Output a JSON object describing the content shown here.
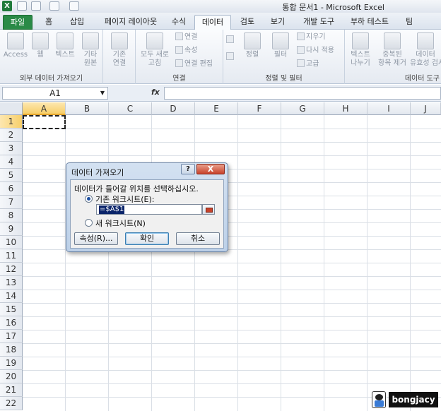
{
  "window": {
    "title": "통합 문서1 - Microsoft Excel"
  },
  "tabs": [
    "파일",
    "홈",
    "삽입",
    "페이지 레이아웃",
    "수식",
    "데이터",
    "검토",
    "보기",
    "개발 도구",
    "부하 테스트",
    "팀"
  ],
  "ribbon": {
    "get_external": {
      "label": "외부 데이터 가져오기",
      "access": "Access",
      "web": "웹",
      "text": "텍스트",
      "other_l1": "기타",
      "other_l2": "원본"
    },
    "existing": {
      "l1": "기존",
      "l2": "연결"
    },
    "connections": {
      "label": "연결",
      "refresh_l1": "모두 새로",
      "refresh_l2": "고침",
      "conn": "연결",
      "props": "속성",
      "edit_links": "연결 편집"
    },
    "sort_filter": {
      "label": "정렬 및 필터",
      "sort": "정렬",
      "filter": "필터",
      "clear": "지우기",
      "reapply": "다시 적용",
      "advanced": "고급"
    },
    "data_tools": {
      "label": "데이터 도구",
      "text_cols_l1": "텍스트",
      "text_cols_l2": "나누기",
      "dup_l1": "중복된",
      "dup_l2": "항목 제거",
      "valid_l1": "데이터",
      "valid_l2": "유효성 검사"
    }
  },
  "formula_bar": {
    "name_box": "A1",
    "fx": "fx",
    "value": ""
  },
  "columns": [
    "A",
    "B",
    "C",
    "D",
    "E",
    "F",
    "G",
    "H",
    "I",
    "J"
  ],
  "rows": [
    "1",
    "2",
    "3",
    "4",
    "5",
    "6",
    "7",
    "8",
    "9",
    "10",
    "11",
    "12",
    "13",
    "14",
    "15",
    "16",
    "17",
    "18",
    "19",
    "20",
    "21",
    "22"
  ],
  "dialog": {
    "title": "데이터 가져오기",
    "help": "?",
    "close": "X",
    "prompt": "데이터가 들어갈 위치를 선택하십시오.",
    "existing_sheet": "기존 워크시트(E):",
    "ref_value": "=$A$1",
    "new_sheet": "새 워크시트(N)",
    "properties": "속성(R)...",
    "ok": "확인",
    "cancel": "취소"
  },
  "watermark": {
    "text": "bongjacy"
  }
}
